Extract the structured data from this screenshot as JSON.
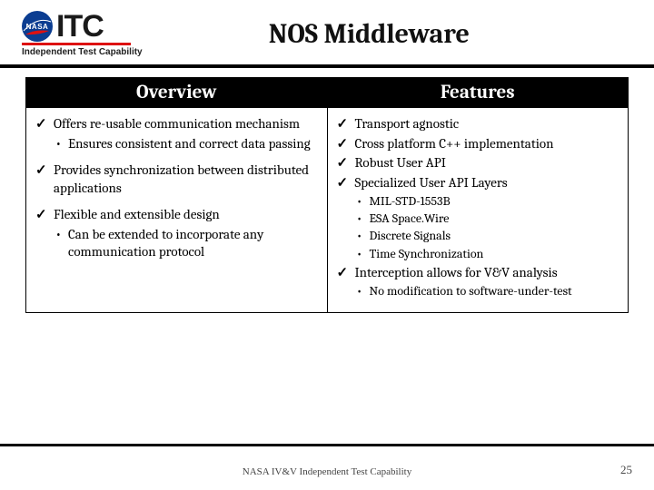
{
  "logo": {
    "nasa": "NASA",
    "itc": "ITC",
    "subtitle": "Independent Test Capability"
  },
  "title": "NOS Middleware",
  "columns": {
    "left": {
      "header": "Overview",
      "items": [
        {
          "text": "Offers re-usable communication mechanism",
          "sub": [
            "Ensures consistent and correct data passing"
          ]
        },
        {
          "text": "Provides synchronization between distributed applications"
        },
        {
          "text": "Flexible and extensible design",
          "sub": [
            "Can be extended to incorporate any communication protocol"
          ]
        }
      ]
    },
    "right": {
      "header": "Features",
      "items": [
        {
          "text": "Transport agnostic"
        },
        {
          "text": "Cross platform C++ implementation"
        },
        {
          "text": "Robust User API"
        },
        {
          "text": "Specialized User API Layers",
          "sub": [
            "MIL-STD-1553B",
            "ESA Space.Wire",
            "Discrete Signals",
            "Time Synchronization"
          ]
        },
        {
          "text": "Interception allows for V&V analysis",
          "sub": [
            "No modification to software-under-test"
          ]
        }
      ]
    }
  },
  "footer": "NASA IV&V Independent Test Capability",
  "page": "25"
}
